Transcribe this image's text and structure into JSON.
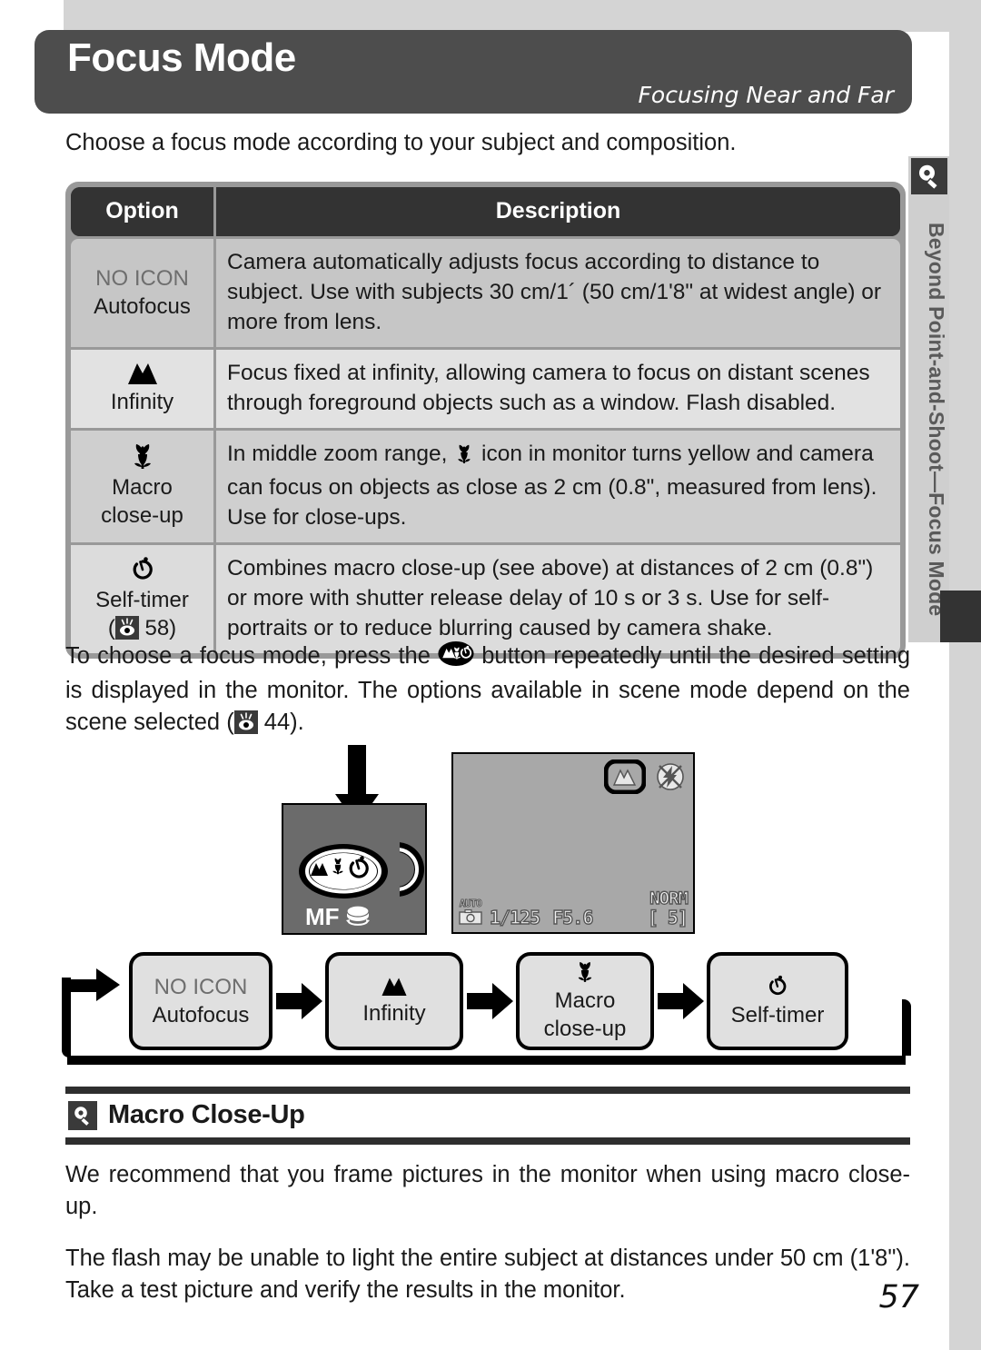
{
  "header": {
    "title": "Focus Mode",
    "subtitle": "Focusing Near and Far"
  },
  "intro": "Choose a focus mode according to your subject and composition.",
  "table": {
    "columns": [
      "Option",
      "Description"
    ],
    "rows": [
      {
        "icon": "no-icon",
        "icon_label": "NO ICON",
        "option": "Autofocus",
        "description": "Camera automatically adjusts focus according to distance to subject.  Use with subjects 30 cm/1´ (50 cm/1ʹ8ʺ at widest angle) or more from lens."
      },
      {
        "icon": "mountain-icon",
        "icon_label": "",
        "option": "Infinity",
        "description": "Focus fixed at infinity, allowing camera to focus on distant scenes through foreground objects such as a window.  Flash disabled."
      },
      {
        "icon": "tulip-icon",
        "icon_label": "",
        "option": "Macro\nclose-up",
        "option_line1": "Macro",
        "option_line2": "close-up",
        "description_pre": "In middle zoom range, ",
        "description_post": " icon in monitor turns yellow and camera can focus on objects as close as 2 cm (0.8ʺ, measured from lens).  Use for close-ups.",
        "inline_icon": "tulip-icon"
      },
      {
        "icon": "self-timer-icon",
        "icon_label": "",
        "option": "Self-timer",
        "option_ref_open": "(",
        "option_ref_page": "58)",
        "description": "Combines macro close-up (see above) at distances of 2 cm (0.8ʺ) or more with shutter release delay of 10 s or 3 s.  Use for self-portraits or to reduce blurring caused by camera shake."
      }
    ]
  },
  "paragraph_after": {
    "part1": "To choose a focus mode, press the ",
    "button_icon": "focus-mode-button-icon",
    "part2": " button repeatedly until the desired setting is displayed in the monitor.  The options available in scene mode depend on the scene selected (",
    "ref_icon": "reference-marker-icon",
    "part3": " 44)."
  },
  "illustration": {
    "camera": {
      "button_icons": [
        "mountain-icon",
        "tulip-icon",
        "self-timer-icon"
      ],
      "mf_label": "MF",
      "mf_dial_icon": "dial-icon",
      "arrow_icon": "down-arrow-icon"
    },
    "monitor": {
      "selected_icon": "mountain-icon",
      "flash_icon": "flash-off-icon",
      "mode_label": "AUTO",
      "mode_icon": "camera-icon",
      "shutter_speed": "1/125",
      "aperture": "F5.6",
      "frames_remaining": "[    5]",
      "quality": "NORM"
    }
  },
  "flow": {
    "steps": [
      {
        "icon": "no-icon",
        "icon_label": "NO ICON",
        "label": "Autofocus"
      },
      {
        "icon": "mountain-icon",
        "icon_label": "",
        "label": "Infinity"
      },
      {
        "icon": "tulip-icon",
        "icon_label": "",
        "label": "Macro",
        "label2": "close-up"
      },
      {
        "icon": "self-timer-icon",
        "icon_label": "",
        "label": "Self-timer"
      }
    ]
  },
  "section": {
    "icon": "magnifier-icon",
    "title": "Macro Close-Up",
    "paragraph1": "We recommend that you frame pictures in the monitor when using macro close-up.",
    "paragraph2": "The flash may be unable to light the entire subject at distances under 50 cm (1ʹ8ʺ).  Take a test picture and verify the results in the monitor."
  },
  "sidebar": {
    "icon": "magnifier-icon",
    "text": "Beyond Point-and-Shoot—Focus Mode"
  },
  "page_number": "57"
}
